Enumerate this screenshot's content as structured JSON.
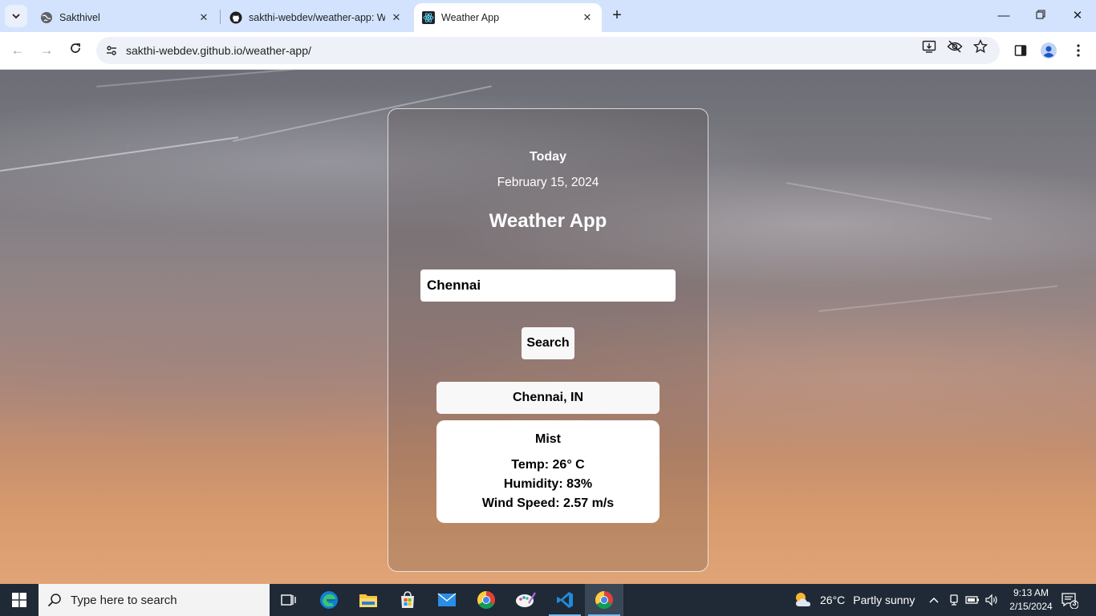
{
  "browser": {
    "tabs": [
      {
        "title": "Sakthivel",
        "active": false
      },
      {
        "title": "sakthi-webdev/weather-app: W",
        "active": false
      },
      {
        "title": "Weather App",
        "active": true
      }
    ],
    "url": "sakthi-webdev.github.io/weather-app/"
  },
  "app": {
    "day_label": "Today",
    "date": "February 15, 2024",
    "title": "Weather App",
    "city_input_value": "Chennai",
    "search_label": "Search",
    "location": "Chennai, IN",
    "condition": "Mist",
    "temp": "Temp: 26° C",
    "humidity": "Humidity: 83%",
    "wind": "Wind Speed: 2.57 m/s"
  },
  "taskbar": {
    "search_placeholder": "Type here to search",
    "weather_temp": "26°C",
    "weather_condition": "Partly sunny",
    "time": "9:13 AM",
    "date": "2/15/2024",
    "notifications": "3"
  },
  "colors": {
    "tabbar_bg": "#d3e3fd",
    "taskbar_bg": "#1f2a36",
    "card_border": "#ffffff"
  }
}
